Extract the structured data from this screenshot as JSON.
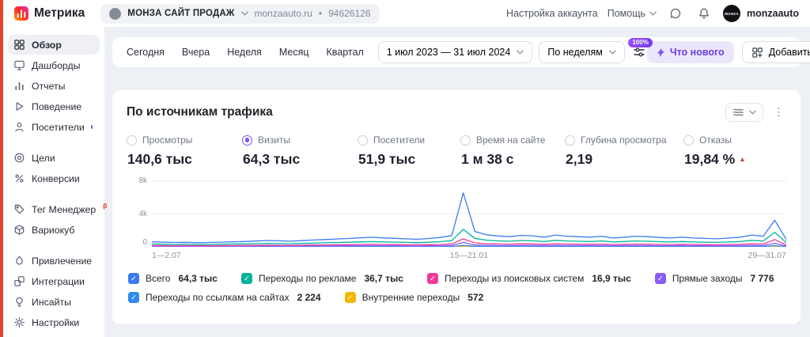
{
  "header": {
    "app_name": "Метрика",
    "counter": {
      "name": "МОНЗА САЙТ ПРОДАЖ",
      "domain": "monzaauto.ru",
      "separator": "•",
      "id": "94626126"
    },
    "nav": {
      "account_settings": "Настройка аккаунта",
      "help": "Помощь"
    },
    "user": {
      "avatar_text": "MONZA",
      "name": "monzaauto"
    }
  },
  "icons": {
    "kebab": "⋮"
  },
  "sidebar": {
    "items": [
      {
        "label": "Обзор"
      },
      {
        "label": "Дашборды"
      },
      {
        "label": "Отчеты"
      },
      {
        "label": "Поведение"
      },
      {
        "label": "Посетители"
      },
      {
        "label": "Цели"
      },
      {
        "label": "Конверсии"
      },
      {
        "label": "Тег Менеджер",
        "beta": "β"
      },
      {
        "label": "Вариокуб"
      },
      {
        "label": "Привлечение"
      },
      {
        "label": "Интеграции"
      },
      {
        "label": "Инсайты"
      },
      {
        "label": "Настройки"
      }
    ]
  },
  "toolbar": {
    "periods": [
      "Сегодня",
      "Вчера",
      "Неделя",
      "Месяц",
      "Квартал"
    ],
    "date_range": "1 июл 2023 — 31 июл 2024",
    "grouping": "По неделям",
    "sampling": "100%",
    "whats_new": "Что нового",
    "add": "Добавить"
  },
  "chart_card": {
    "title": "По источникам трафика",
    "metrics": [
      {
        "label": "Просмотры",
        "value": "140,6 тыс",
        "selected": false
      },
      {
        "label": "Визиты",
        "value": "64,3 тыс",
        "selected": true
      },
      {
        "label": "Посетители",
        "value": "51,9 тыс",
        "selected": false
      },
      {
        "label": "Время на сайте",
        "value": "1 м 38 с",
        "selected": false
      },
      {
        "label": "Глубина просмотра",
        "value": "2,19",
        "selected": false
      },
      {
        "label": "Отказы",
        "value": "19,84 %",
        "selected": false,
        "trend": "▲"
      }
    ],
    "legend": [
      {
        "label": "Всего",
        "value": "64,3 тыс",
        "color": "#3b7cf0",
        "checked": true
      },
      {
        "label": "Переходы по рекламе",
        "value": "36,7 тыс",
        "color": "#00b39a",
        "checked": true
      },
      {
        "label": "Переходы из поисковых систем",
        "value": "16,9 тыс",
        "color": "#ef3a9b",
        "checked": true
      },
      {
        "label": "Прямые заходы",
        "value": "7 776",
        "color": "#8a5cf5",
        "checked": true
      },
      {
        "label": "Переходы по ссылкам на сайтах",
        "value": "2 224",
        "color": "#2f8af0",
        "checked": true
      },
      {
        "label": "Внутренние переходы",
        "value": "572",
        "color": "#f7b500",
        "checked": true
      }
    ]
  },
  "chart_data": {
    "type": "line",
    "title": "По источникам трафика",
    "x_unit": "weeks, 1 июл 2023 — 31 июл 2024",
    "x_tick_labels": [
      "1—2.07",
      "15—21.01",
      "29—31.07"
    ],
    "y_ticks": [
      0,
      4000,
      8000
    ],
    "y_tick_labels": [
      "0",
      "4k",
      "8k"
    ],
    "ylim": [
      0,
      8000
    ],
    "grid": true,
    "legend_position": "bottom",
    "series": [
      {
        "name": "Всего",
        "color": "#3b7cf0",
        "values": [
          600,
          550,
          520,
          540,
          500,
          520,
          560,
          600,
          640,
          700,
          760,
          720,
          680,
          740,
          820,
          880,
          940,
          1000,
          1080,
          1150,
          1080,
          1020,
          960,
          900,
          1000,
          1120,
          1350,
          6500,
          1850,
          1450,
          1300,
          1220,
          1380,
          1320,
          1160,
          1420,
          1280,
          1220,
          1160,
          1280,
          1060,
          1160,
          1280,
          1220,
          1120,
          1060,
          1160,
          1060,
          1010,
          960,
          1060,
          1160,
          1420,
          1280,
          3200,
          900
        ]
      },
      {
        "name": "Переходы по рекламе",
        "color": "#00b39a",
        "values": [
          330,
          300,
          285,
          295,
          275,
          285,
          310,
          330,
          350,
          385,
          420,
          395,
          375,
          405,
          450,
          485,
          515,
          550,
          595,
          630,
          595,
          560,
          530,
          495,
          550,
          615,
          740,
          2100,
          1020,
          800,
          715,
          670,
          760,
          725,
          640,
          780,
          705,
          670,
          640,
          705,
          585,
          640,
          705,
          670,
          615,
          585,
          640,
          585,
          555,
          530,
          585,
          640,
          780,
          705,
          1750,
          495
        ]
      },
      {
        "name": "Переходы из поисковых систем",
        "color": "#ef3a9b",
        "values": [
          155,
          145,
          135,
          140,
          130,
          135,
          145,
          155,
          165,
          180,
          200,
          185,
          175,
          190,
          215,
          230,
          245,
          260,
          280,
          300,
          280,
          265,
          250,
          235,
          260,
          290,
          350,
          950,
          480,
          375,
          340,
          315,
          360,
          345,
          300,
          370,
          330,
          315,
          300,
          330,
          275,
          300,
          330,
          315,
          290,
          275,
          300,
          275,
          260,
          250,
          275,
          300,
          370,
          330,
          880,
          235
        ]
      },
      {
        "name": "Прямые заходы",
        "color": "#8a5cf5",
        "values": [
          70,
          66,
          62,
          65,
          60,
          62,
          67,
          72,
          77,
          84,
          91,
          86,
          82,
          89,
          98,
          106,
          113,
          120,
          130,
          138,
          130,
          122,
          115,
          108,
          120,
          134,
          162,
          520,
          222,
          174,
          156,
          146,
          166,
          158,
          139,
          170,
          154,
          146,
          139,
          154,
          127,
          139,
          154,
          146,
          134,
          127,
          139,
          127,
          121,
          115,
          127,
          139,
          170,
          154,
          420,
          108
        ]
      },
      {
        "name": "Переходы по ссылкам на сайтах",
        "color": "#2f8af0",
        "values": [
          21,
          19,
          18,
          19,
          18,
          18,
          20,
          21,
          22,
          25,
          27,
          25,
          24,
          26,
          29,
          31,
          33,
          35,
          38,
          40,
          38,
          36,
          34,
          32,
          35,
          39,
          47,
          170,
          65,
          51,
          46,
          43,
          48,
          46,
          41,
          50,
          45,
          43,
          41,
          45,
          37,
          41,
          45,
          43,
          39,
          37,
          41,
          37,
          35,
          34,
          37,
          41,
          50,
          45,
          130,
          32
        ]
      },
      {
        "name": "Внутренние переходы",
        "color": "#f7b500",
        "values": [
          5,
          5,
          5,
          5,
          5,
          5,
          5,
          5,
          6,
          6,
          7,
          6,
          6,
          7,
          7,
          8,
          8,
          9,
          10,
          10,
          10,
          9,
          9,
          8,
          9,
          10,
          12,
          45,
          17,
          13,
          12,
          11,
          12,
          12,
          10,
          13,
          12,
          11,
          10,
          12,
          10,
          10,
          12,
          11,
          10,
          10,
          10,
          10,
          9,
          9,
          10,
          10,
          13,
          12,
          35,
          8
        ]
      }
    ]
  }
}
